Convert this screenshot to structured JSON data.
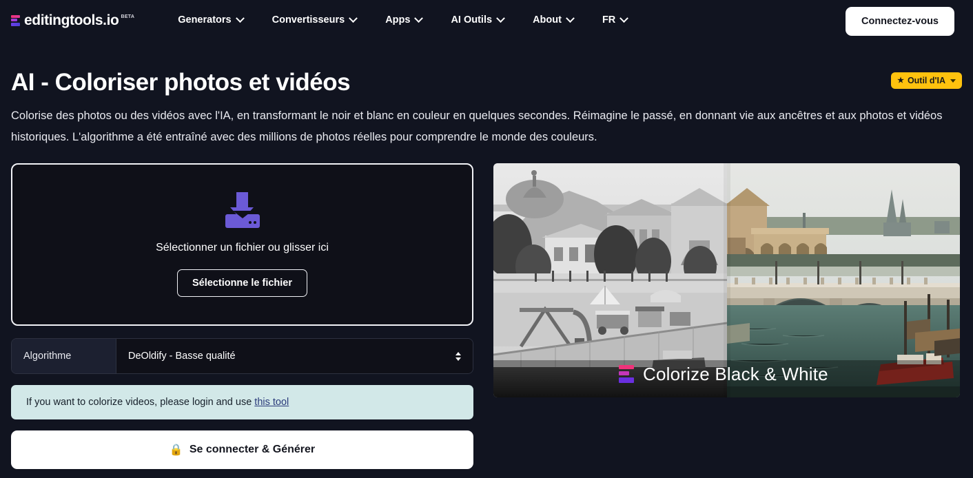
{
  "header": {
    "logo_text": "editingtools.io",
    "logo_beta": "BETA",
    "nav": [
      {
        "label": "Generators"
      },
      {
        "label": "Convertisseurs"
      },
      {
        "label": "Apps"
      },
      {
        "label": "AI Outils"
      },
      {
        "label": "About"
      },
      {
        "label": "FR"
      }
    ],
    "login_label": "Connectez-vous"
  },
  "page": {
    "title": "AI - Coloriser photos et vidéos",
    "badge_label": "Outil d'IA",
    "badge_star": "★",
    "description": "Colorise des photos ou des vidéos avec l'IA, en transformant le noir et blanc en couleur en quelques secondes. Réimagine le passé, en donnant vie aux ancêtres et aux photos et vidéos historiques. L'algorithme a été entraîné avec des millions de photos réelles pour comprendre le monde des couleurs."
  },
  "uploader": {
    "hint": "Sélectionner un fichier ou glisser ici",
    "button_label": "Sélectionne le fichier"
  },
  "algorithm": {
    "label": "Algorithme",
    "selected": "DeOldify - Basse qualité",
    "options": [
      "DeOldify - Basse qualité"
    ]
  },
  "info": {
    "text_before": "If you want to colorize videos, please login and use ",
    "link_label": "this tool"
  },
  "generate": {
    "icon": "🔒",
    "label": "Se connecter & Générer"
  },
  "demo": {
    "caption": "Colorize Black & White"
  },
  "colors": {
    "page_bg": "#111420",
    "accent_purple": "#6b5ad6",
    "badge_yellow": "#ffc20e",
    "info_bg": "#d2e8e8",
    "link": "#2a3a7a",
    "brand_pink": "#f0327a",
    "brand_violet": "#6a2fe0"
  }
}
